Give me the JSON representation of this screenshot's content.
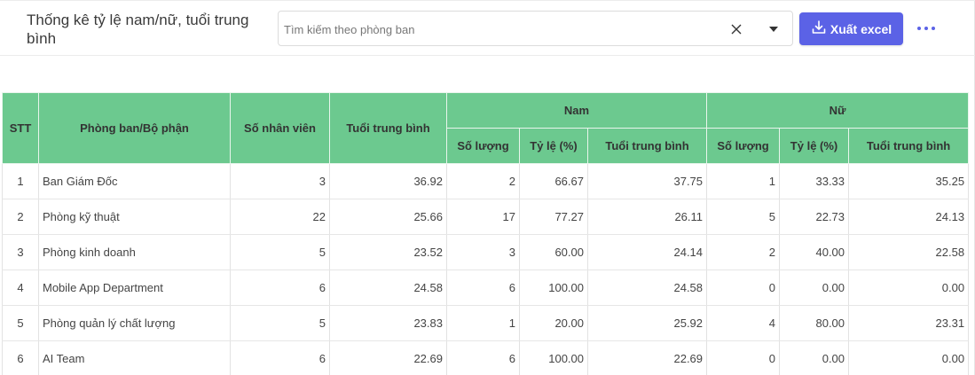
{
  "page": {
    "title": "Thống kê tỷ lệ nam/nữ, tuổi trung bình"
  },
  "search": {
    "placeholder": "Tìm kiếm theo phòng ban",
    "value": ""
  },
  "actions": {
    "export_label": "Xuất excel"
  },
  "colors": {
    "accent": "#5b62e6",
    "table_header": "#6cc98f"
  },
  "table": {
    "headers": {
      "stt": "STT",
      "department": "Phòng ban/Bộ phận",
      "employees": "Số nhân viên",
      "avg_age": "Tuổi trung bình",
      "male_group": "Nam",
      "female_group": "Nữ",
      "count": "Số lượng",
      "ratio": "Tỷ lệ (%)",
      "group_avg_age": "Tuổi trung bình"
    },
    "rows": [
      {
        "stt": "1",
        "department": "Ban Giám Đốc",
        "employees": "3",
        "avg_age": "36.92",
        "male_count": "2",
        "male_ratio": "66.67",
        "male_avg_age": "37.75",
        "female_count": "1",
        "female_ratio": "33.33",
        "female_avg_age": "35.25"
      },
      {
        "stt": "2",
        "department": "Phòng kỹ thuật",
        "employees": "22",
        "avg_age": "25.66",
        "male_count": "17",
        "male_ratio": "77.27",
        "male_avg_age": "26.11",
        "female_count": "5",
        "female_ratio": "22.73",
        "female_avg_age": "24.13"
      },
      {
        "stt": "3",
        "department": "Phòng kinh doanh",
        "employees": "5",
        "avg_age": "23.52",
        "male_count": "3",
        "male_ratio": "60.00",
        "male_avg_age": "24.14",
        "female_count": "2",
        "female_ratio": "40.00",
        "female_avg_age": "22.58"
      },
      {
        "stt": "4",
        "department": "Mobile App Department",
        "employees": "6",
        "avg_age": "24.58",
        "male_count": "6",
        "male_ratio": "100.00",
        "male_avg_age": "24.58",
        "female_count": "0",
        "female_ratio": "0.00",
        "female_avg_age": "0.00"
      },
      {
        "stt": "5",
        "department": "Phòng quản lý chất lượng",
        "employees": "5",
        "avg_age": "23.83",
        "male_count": "1",
        "male_ratio": "20.00",
        "male_avg_age": "25.92",
        "female_count": "4",
        "female_ratio": "80.00",
        "female_avg_age": "23.31"
      },
      {
        "stt": "6",
        "department": "AI Team",
        "employees": "6",
        "avg_age": "22.69",
        "male_count": "6",
        "male_ratio": "100.00",
        "male_avg_age": "22.69",
        "female_count": "0",
        "female_ratio": "0.00",
        "female_avg_age": "0.00"
      }
    ]
  }
}
